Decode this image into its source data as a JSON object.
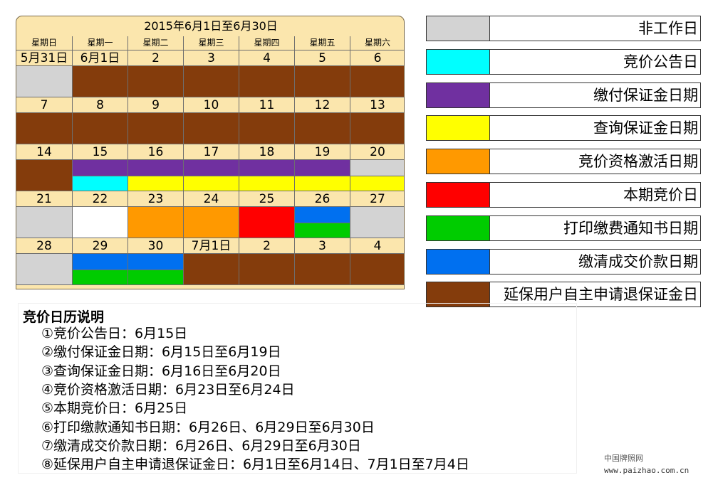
{
  "calendar": {
    "title": "2015年6月1日至6月30日",
    "weekdays": [
      "星期日",
      "星期一",
      "星期二",
      "星期三",
      "星期四",
      "星期五",
      "星期六"
    ],
    "weeks": [
      {
        "days": [
          "5月31日",
          "6月1日",
          "2",
          "3",
          "4",
          "5",
          "6"
        ],
        "blocks": [
          [
            "gray"
          ],
          [
            "brown"
          ],
          [
            "brown"
          ],
          [
            "brown"
          ],
          [
            "brown"
          ],
          [
            "brown"
          ],
          [
            "brown"
          ]
        ]
      },
      {
        "days": [
          "7",
          "8",
          "9",
          "10",
          "11",
          "12",
          "13"
        ],
        "blocks": [
          [
            "brown"
          ],
          [
            "brown"
          ],
          [
            "brown"
          ],
          [
            "brown"
          ],
          [
            "brown"
          ],
          [
            "brown"
          ],
          [
            "brown"
          ]
        ]
      },
      {
        "days": [
          "14",
          "15",
          "16",
          "17",
          "18",
          "19",
          "20"
        ],
        "blocks": [
          [
            "brown"
          ],
          [
            "purple",
            "cyan"
          ],
          [
            "purple",
            "yellow"
          ],
          [
            "purple",
            "yellow"
          ],
          [
            "purple",
            "yellow"
          ],
          [
            "purple",
            "yellow"
          ],
          [
            "gray",
            "yellow"
          ]
        ]
      },
      {
        "days": [
          "21",
          "22",
          "23",
          "24",
          "25",
          "26",
          "27"
        ],
        "blocks": [
          [
            "gray"
          ],
          [
            "white"
          ],
          [
            "orange"
          ],
          [
            "orange"
          ],
          [
            "red"
          ],
          [
            "blue",
            "green"
          ],
          [
            "gray"
          ]
        ]
      },
      {
        "days": [
          "28",
          "29",
          "30",
          "7月1日",
          "2",
          "3",
          "4"
        ],
        "blocks": [
          [
            "gray"
          ],
          [
            "blue",
            "green"
          ],
          [
            "blue",
            "green"
          ],
          [
            "brown"
          ],
          [
            "brown"
          ],
          [
            "brown"
          ],
          [
            "brown"
          ]
        ]
      }
    ]
  },
  "colors": {
    "gray": "#d3d3d3",
    "cyan": "#00ffff",
    "purple": "#7030a0",
    "yellow": "#ffff00",
    "orange": "#ff9900",
    "red": "#ff0000",
    "green": "#00cc00",
    "blue": "#0070f0",
    "brown": "#843c0c",
    "white": "#ffffff"
  },
  "legend": [
    {
      "color": "gray",
      "label": "非工作日"
    },
    {
      "color": "cyan",
      "label": "竞价公告日"
    },
    {
      "color": "purple",
      "label": "缴付保证金日期"
    },
    {
      "color": "yellow",
      "label": "查询保证金日期"
    },
    {
      "color": "orange",
      "label": "竞价资格激活日期"
    },
    {
      "color": "red",
      "label": "本期竞价日"
    },
    {
      "color": "green",
      "label": "打印缴费通知书日期"
    },
    {
      "color": "blue",
      "label": "缴清成交价款日期"
    },
    {
      "color": "brown",
      "label": "延保用户自主申请退保证金日"
    }
  ],
  "notes": {
    "title": "竞价日历说明",
    "items": [
      "①竞价公告日：6月15日",
      "②缴付保证金日期：6月15日至6月19日",
      "③查询保证金日期：6月16日至6月20日",
      "④竞价资格激活日期：6月23日至6月24日",
      "⑤本期竞价日：6月25日",
      "⑥打印缴款通知书日期：6月26日、6月29日至6月30日",
      "⑦缴清成交价款日期：6月26日、6月29日至6月30日",
      "⑧延保用户自主申请退保证金日：6月1日至6月14日、7月1日至7月4日"
    ]
  },
  "watermark": {
    "line1": "中国牌照网",
    "line2": "www.paizhao.com.cn"
  }
}
